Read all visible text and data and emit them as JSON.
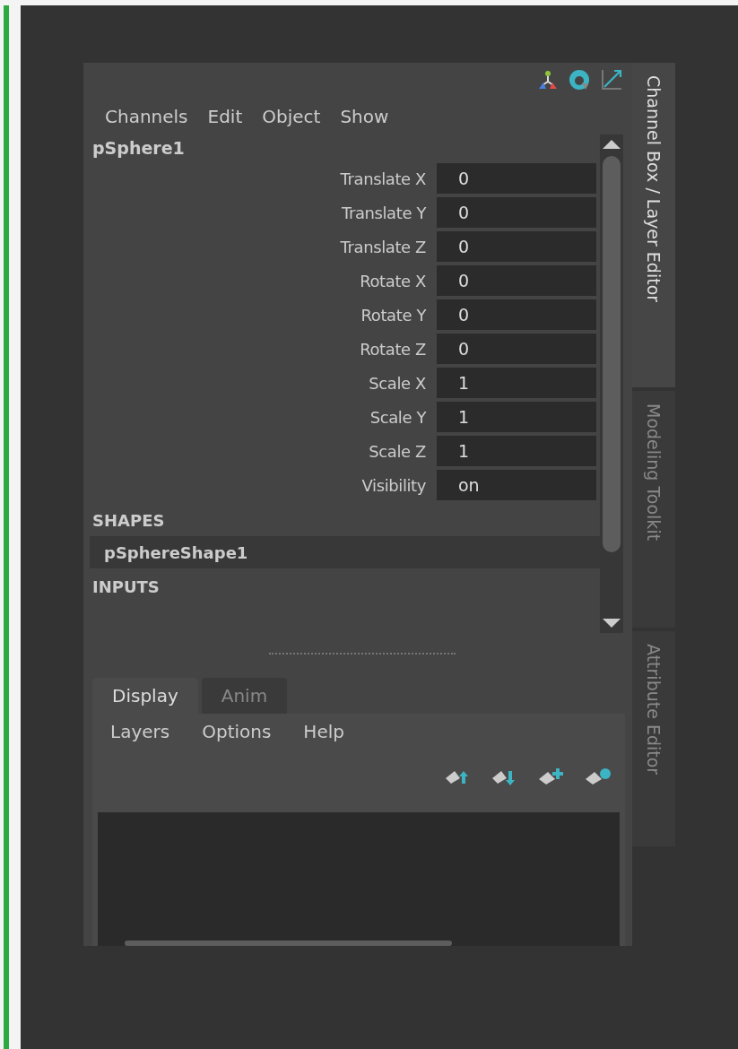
{
  "channel_box": {
    "menu": [
      "Channels",
      "Edit",
      "Object",
      "Show"
    ],
    "object": "pSphere1",
    "channels": [
      {
        "name": "Translate X",
        "value": "0"
      },
      {
        "name": "Translate Y",
        "value": "0"
      },
      {
        "name": "Translate Z",
        "value": "0"
      },
      {
        "name": "Rotate X",
        "value": "0"
      },
      {
        "name": "Rotate Y",
        "value": "0"
      },
      {
        "name": "Rotate Z",
        "value": "0"
      },
      {
        "name": "Scale X",
        "value": "1"
      },
      {
        "name": "Scale Y",
        "value": "1"
      },
      {
        "name": "Scale Z",
        "value": "1"
      },
      {
        "name": "Visibility",
        "value": "on"
      }
    ],
    "shapes_header": "SHAPES",
    "shapes": [
      {
        "name": "pSphereShape1",
        "selected": true
      }
    ],
    "inputs_header": "INPUTS"
  },
  "layer_editor": {
    "tabs": [
      {
        "label": "Display",
        "selected": true
      },
      {
        "label": "Anim",
        "selected": false
      }
    ],
    "menu": [
      "Layers",
      "Options",
      "Help"
    ]
  },
  "side_tabs": [
    {
      "label": "Channel Box / Layer Editor",
      "selected": true
    },
    {
      "label": "Modeling Toolkit",
      "selected": false
    },
    {
      "label": "Attribute Editor",
      "selected": false
    }
  ]
}
